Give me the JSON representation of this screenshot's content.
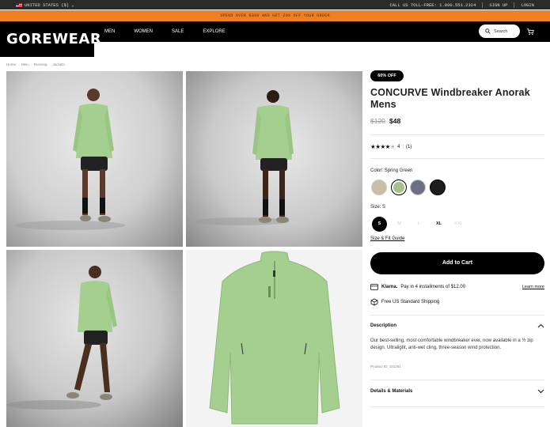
{
  "utility": {
    "country": "UNITED STATES ($)",
    "phone_label": "CALL US TOLL-FREE: 1.800.551.2324",
    "sign_up": "SIGN UP",
    "login": "LOGIN"
  },
  "promo": {
    "text": "SPEND OVER $300 AND GET 20% OFF YOUR ORDER"
  },
  "header": {
    "logo": "GOREWEAR",
    "nav": [
      "MEN",
      "WOMEN",
      "SALE",
      "EXPLORE"
    ],
    "search_label": "Search"
  },
  "breadcrumb": [
    "Home",
    "Men",
    "Running",
    "Jackets"
  ],
  "product": {
    "badge": "60% OFF",
    "title": "CONCURVE Windbreaker Anorak Mens",
    "price_old": "$120",
    "price_new": "$48",
    "rating_value": "4",
    "rating_count": "(1)",
    "stars_filled": 4,
    "color_label": "Color:",
    "color_value": "Spring Green",
    "swatches": [
      {
        "name": "Beige",
        "hex": "#c8c0a6"
      },
      {
        "name": "Spring Green",
        "hex": "#a8c08c"
      },
      {
        "name": "Slate",
        "hex": "#6d6f85"
      },
      {
        "name": "Black",
        "hex": "#1d1d1d"
      }
    ],
    "size_label": "Size:",
    "size_value": "S",
    "sizes": [
      "S",
      "M",
      "L",
      "XL",
      "XXL"
    ],
    "fit_guide": "Size & Fit Guide",
    "add_to_cart": "Add to Cart",
    "klarna_brand": "Klarna.",
    "klarna_text": "Pay in 4 installments of $12.00",
    "learn_more": "Learn more",
    "shipping": "Free US Standard Shipping",
    "description_title": "Description",
    "description_text": "Our best-selling, most comfortable windbreaker ever, now available in a ½ zip design. Ultralight, anti-wet cling, three-season wind protection.",
    "product_id": "Product ID: 101261",
    "details_title": "Details & Materials"
  },
  "colors": {
    "accent": "#f07f21",
    "jacket": "#a4cf8e",
    "black": "#000000"
  }
}
